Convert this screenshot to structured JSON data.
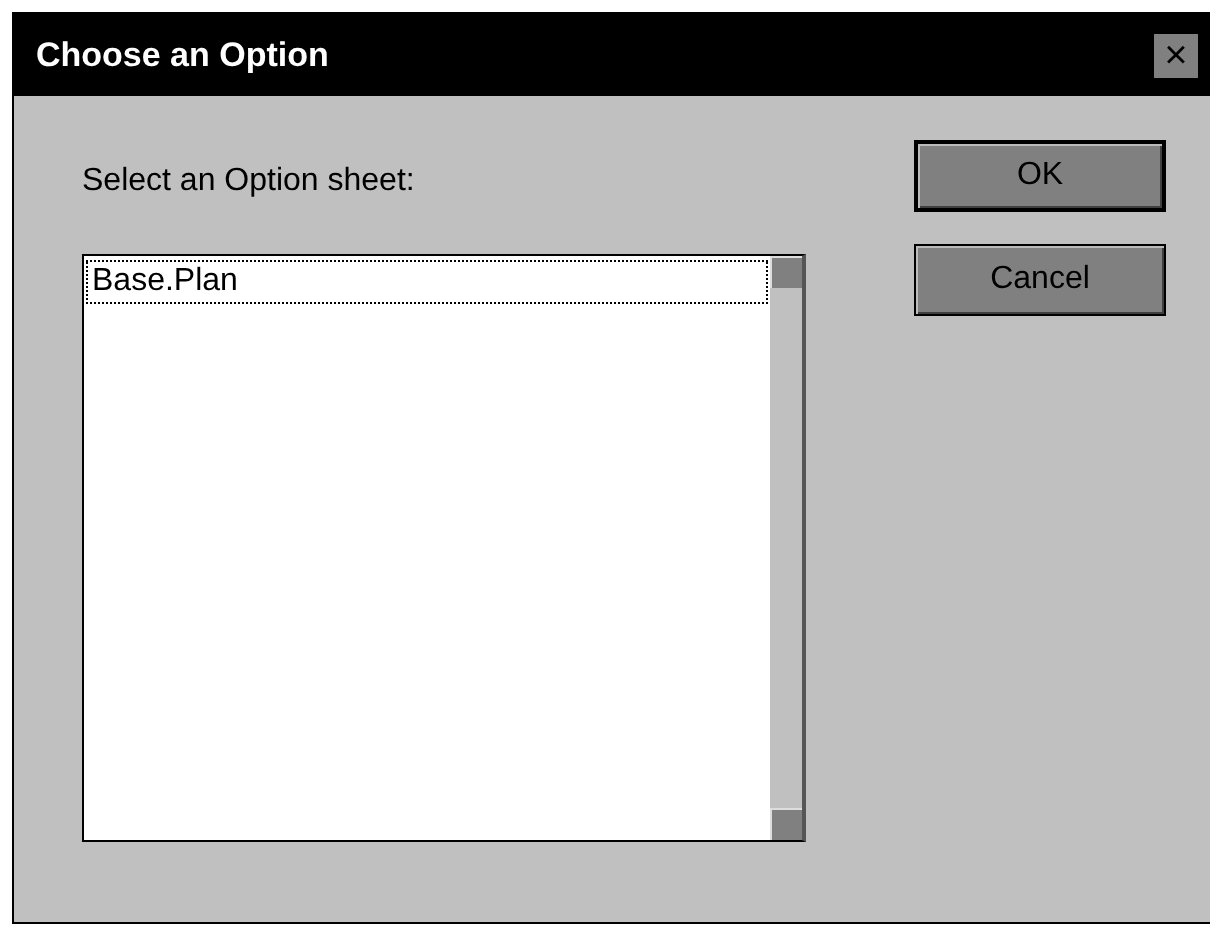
{
  "window": {
    "title": "Choose an Option",
    "close": "×"
  },
  "prompt": "Select an Option sheet:",
  "list": {
    "items": [
      {
        "label": "Base.Plan",
        "selected": true
      }
    ]
  },
  "buttons": [
    {
      "label": "OK",
      "default": true
    },
    {
      "label": "Cancel",
      "default": false
    }
  ]
}
